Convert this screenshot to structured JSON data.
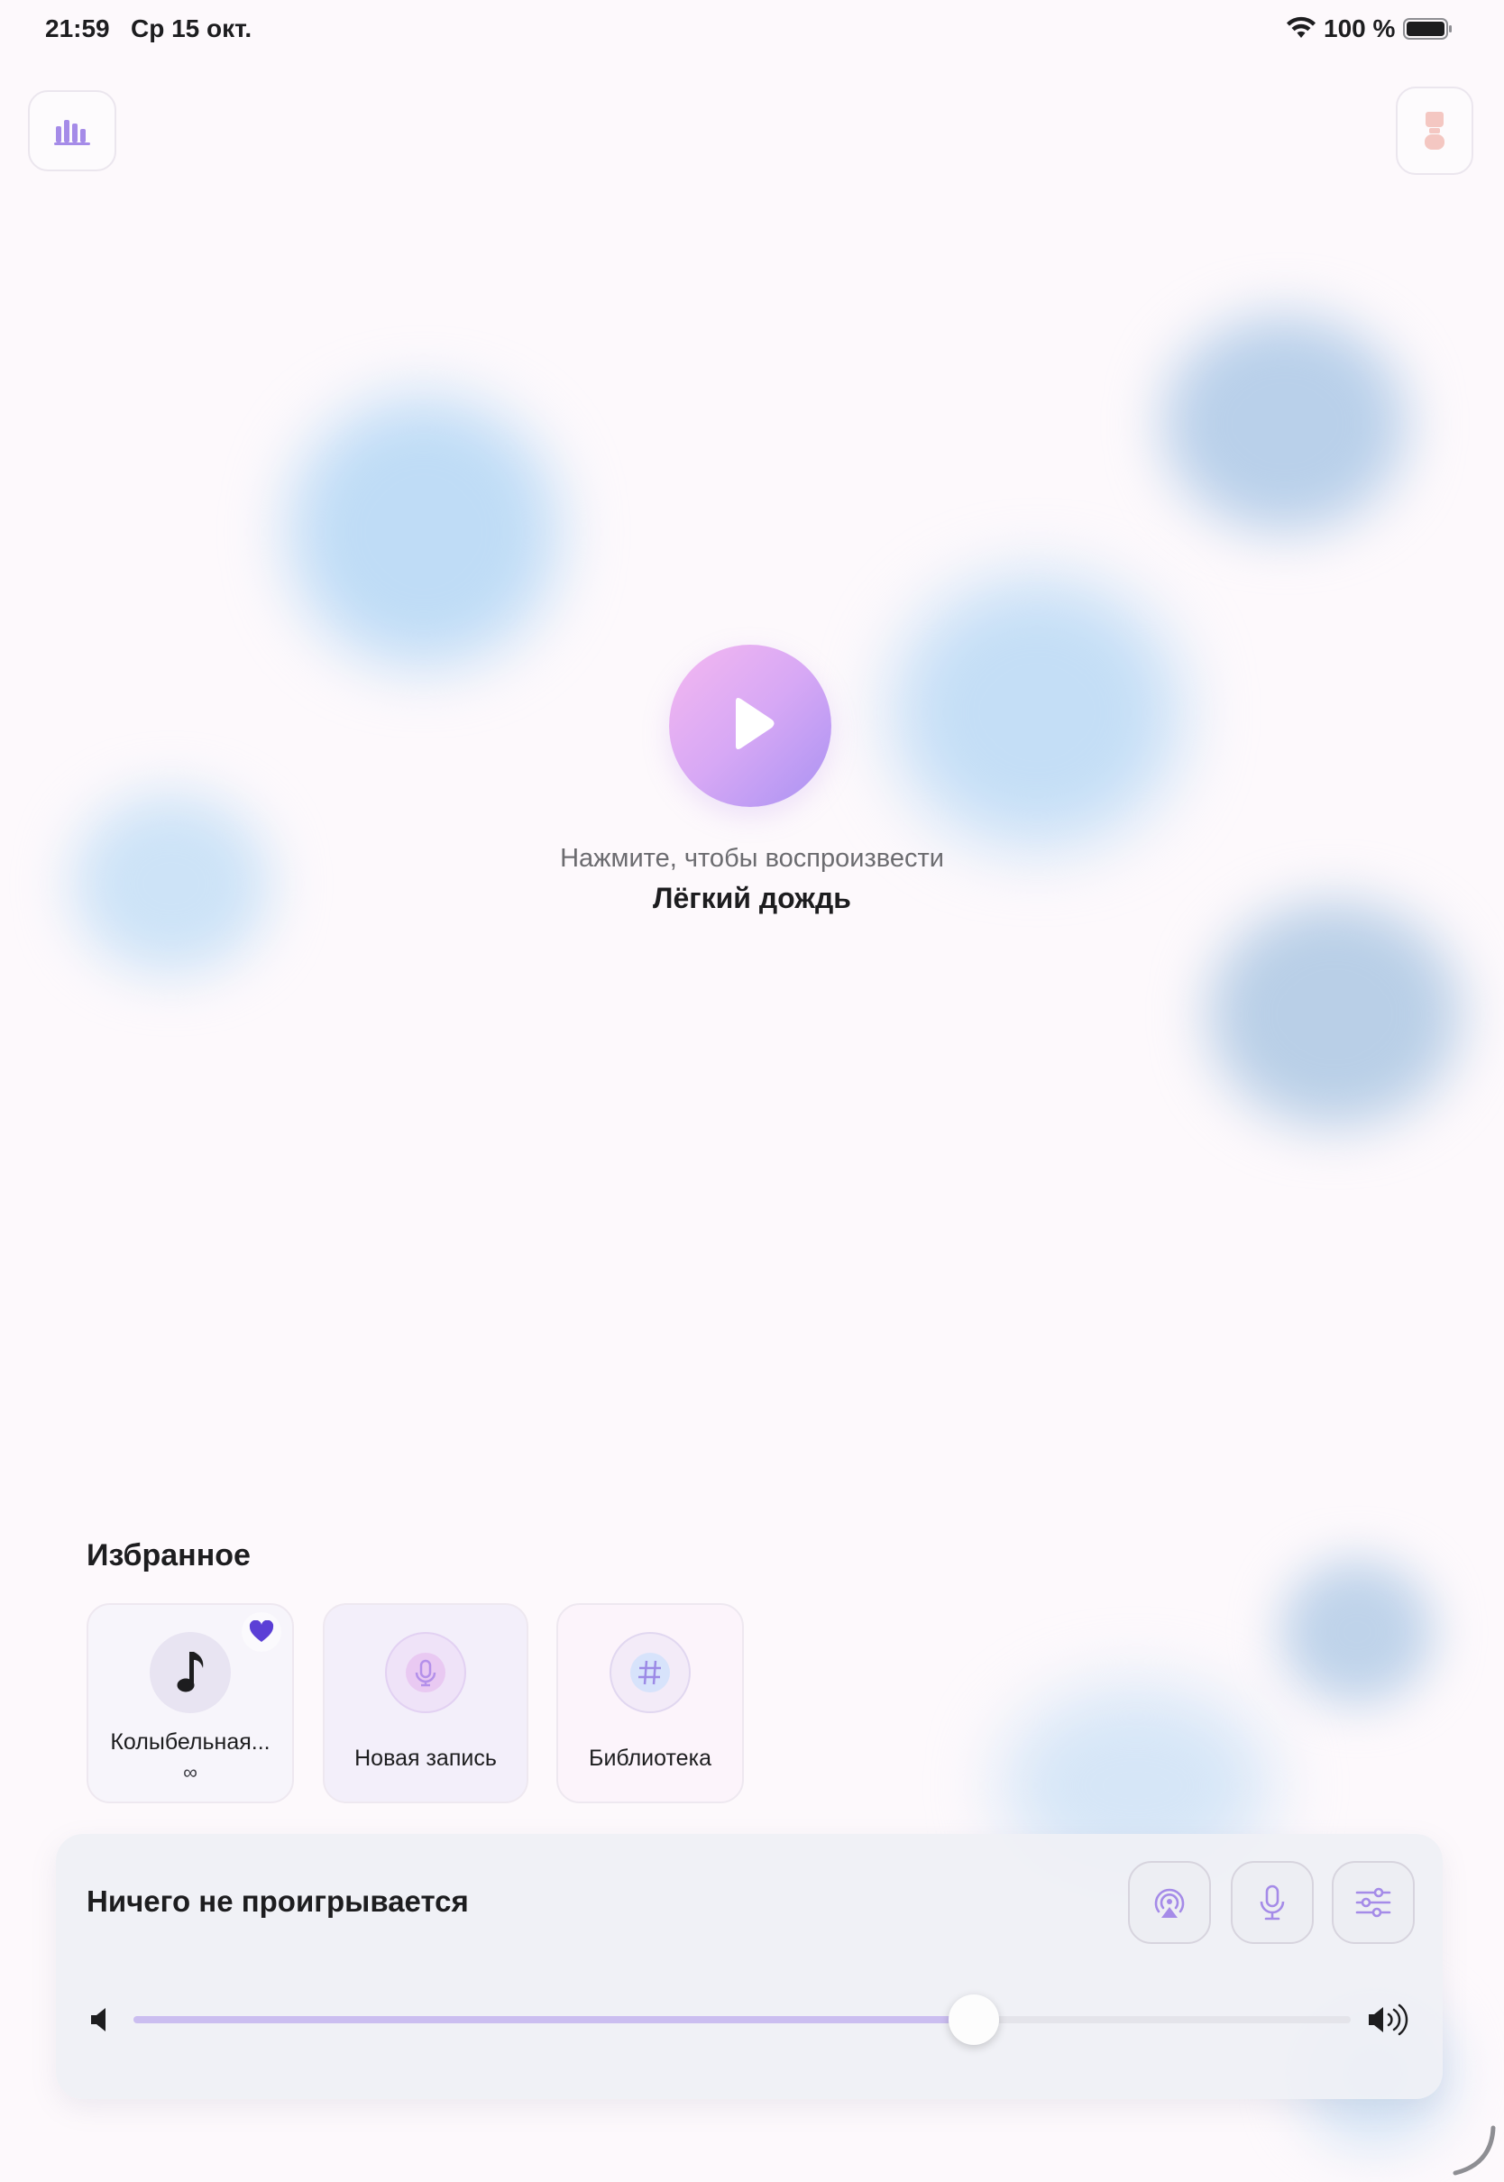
{
  "status_bar": {
    "time": "21:59",
    "date": "Ср 15 окт.",
    "battery": "100 %"
  },
  "main": {
    "play_hint": "Нажмите, чтобы воспроизвести",
    "sound_name": "Лёгкий дождь"
  },
  "favorites": {
    "title": "Избранное",
    "items": [
      {
        "label": "Колыбельная...",
        "sub": "∞",
        "icon": "music-note-icon",
        "favorite": true
      },
      {
        "label": "Новая запись",
        "icon": "microphone-icon"
      },
      {
        "label": "Библиотека",
        "icon": "hashtag-icon"
      }
    ]
  },
  "player": {
    "status": "Ничего не проигрывается",
    "volume": 0.69
  },
  "colors": {
    "accent": "#9b7fe6",
    "heart": "#5b3fd6",
    "play_gradient_start": "#f5b8f0",
    "play_gradient_end": "#a992f2",
    "background": "#fdf9fc"
  }
}
